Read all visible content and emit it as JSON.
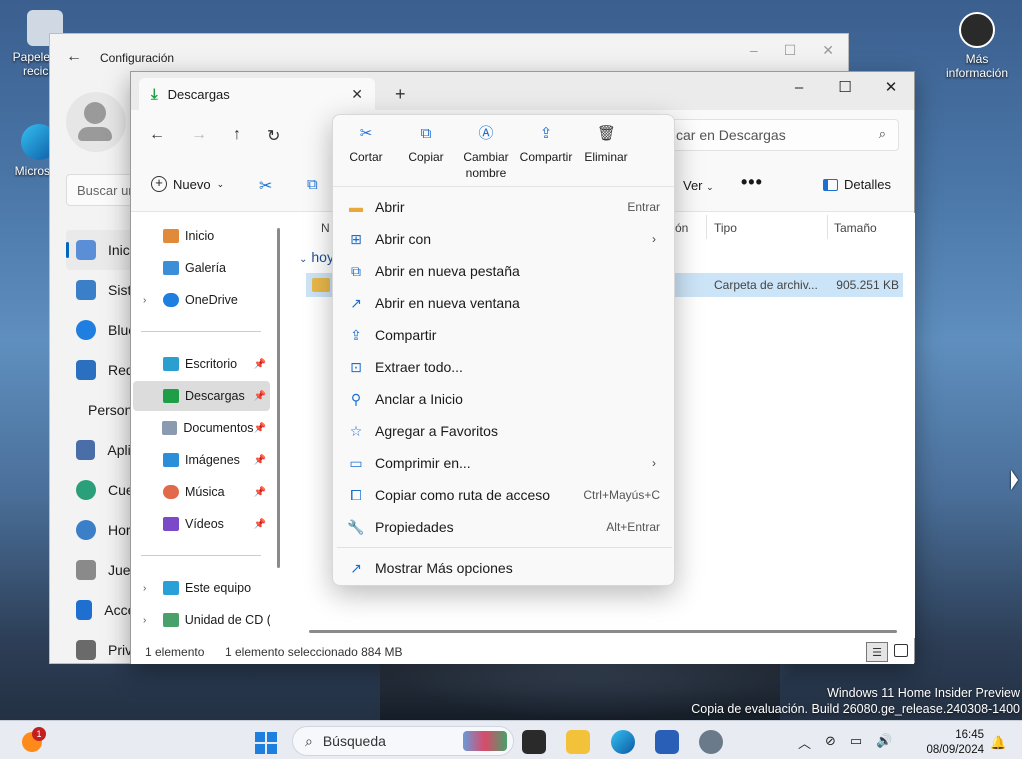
{
  "desktop": {
    "icons": [
      {
        "label": "Papelera de reciclaje"
      },
      {
        "label": "Microsoft Edge"
      },
      {
        "label": "Más información"
      }
    ]
  },
  "settings": {
    "title": "Configuración",
    "search_placeholder": "Buscar un",
    "nav": [
      {
        "label": "Inicio",
        "icon": "home-icon"
      },
      {
        "label": "Sistema",
        "icon": "system-icon"
      },
      {
        "label": "Bluetooth",
        "icon": "bluetooth-icon"
      },
      {
        "label": "Red",
        "icon": "wifi-icon"
      },
      {
        "label": "Personalización",
        "icon": "brush-icon"
      },
      {
        "label": "Aplicaciones",
        "icon": "apps-icon"
      },
      {
        "label": "Cuentas",
        "icon": "account-icon"
      },
      {
        "label": "Hora",
        "icon": "clock-icon"
      },
      {
        "label": "Juegos",
        "icon": "gamepad-icon"
      },
      {
        "label": "Accesibilidad",
        "icon": "accessibility-icon"
      },
      {
        "label": "Privacidad",
        "icon": "shield-icon"
      }
    ]
  },
  "explorer": {
    "tab_label": "Descargas",
    "search_placeholder": "car en Descargas",
    "toolbar": {
      "new_label": "Nuevo",
      "view_label": "Ver",
      "more_label": "•••",
      "details_label": "Detalles"
    },
    "sidebar": [
      {
        "label": "Inicio",
        "pinned": false,
        "chev": false
      },
      {
        "label": "Galería",
        "pinned": false,
        "chev": false
      },
      {
        "label": "OneDrive",
        "pinned": false,
        "chev": true
      },
      {
        "label": "Escritorio",
        "pinned": true,
        "chev": false
      },
      {
        "label": "Descargas",
        "pinned": true,
        "chev": false
      },
      {
        "label": "Documentos",
        "pinned": true,
        "chev": false
      },
      {
        "label": "Imágenes",
        "pinned": true,
        "chev": false
      },
      {
        "label": "Música",
        "pinned": true,
        "chev": false
      },
      {
        "label": "Vídeos",
        "pinned": true,
        "chev": false
      },
      {
        "label": "Este equipo",
        "pinned": false,
        "chev": true
      },
      {
        "label": "Unidad de CD (D",
        "pinned": false,
        "chev": true
      }
    ],
    "columns": {
      "name": "N",
      "date": "ón",
      "type": "Tipo",
      "size": "Tamaño"
    },
    "group": "hoy",
    "row": {
      "type": "Carpeta de archiv...",
      "size": "905.251 KB"
    },
    "status": {
      "count": "1 elemento",
      "selected": "1 elemento seleccionado  884 MB"
    }
  },
  "context_menu": {
    "top_actions": [
      {
        "label": "Cortar",
        "icon": "scissors-icon"
      },
      {
        "label": "Copiar",
        "icon": "copy-icon"
      },
      {
        "label": "Cambiar nombre",
        "icon": "rename-icon"
      },
      {
        "label": "Compartir",
        "icon": "share-icon"
      },
      {
        "label": "Eliminar",
        "icon": "trash-icon"
      }
    ],
    "items": [
      {
        "label": "Abrir",
        "shortcut": "Entrar",
        "submenu": false,
        "icon": "folder-open-icon"
      },
      {
        "label": "Abrir con",
        "shortcut": "",
        "submenu": true,
        "icon": "open-with-icon"
      },
      {
        "label": "Abrir en nueva pestaña",
        "shortcut": "",
        "submenu": false,
        "icon": "new-tab-icon"
      },
      {
        "label": "Abrir en nueva ventana",
        "shortcut": "",
        "submenu": false,
        "icon": "new-window-icon"
      },
      {
        "label": "Compartir",
        "shortcut": "",
        "submenu": false,
        "icon": "share-icon"
      },
      {
        "label": "Extraer todo...",
        "shortcut": "",
        "submenu": false,
        "icon": "extract-icon"
      },
      {
        "label": "Anclar a Inicio",
        "shortcut": "",
        "submenu": false,
        "icon": "pin-icon"
      },
      {
        "label": "Agregar a Favoritos",
        "shortcut": "",
        "submenu": false,
        "icon": "star-icon"
      },
      {
        "label": "Comprimir en...",
        "shortcut": "",
        "submenu": true,
        "icon": "compress-icon"
      },
      {
        "label": "Copiar como ruta de acceso",
        "shortcut": "Ctrl+Mayús+C",
        "submenu": false,
        "icon": "path-icon"
      },
      {
        "label": "Propiedades",
        "shortcut": "Alt+Entrar",
        "submenu": false,
        "icon": "wrench-icon"
      }
    ],
    "more_options": {
      "label": "Mostrar Más opciones",
      "icon": "more-options-icon"
    }
  },
  "watermark": {
    "line1": "Windows 11 Home Insider Preview",
    "line2": "Copia de evaluación. Build 26080.ge_release.240308-1400"
  },
  "taskbar": {
    "badge": "1",
    "search_placeholder": "Búsqueda",
    "time": "16:45",
    "date": "08/09/2024"
  }
}
